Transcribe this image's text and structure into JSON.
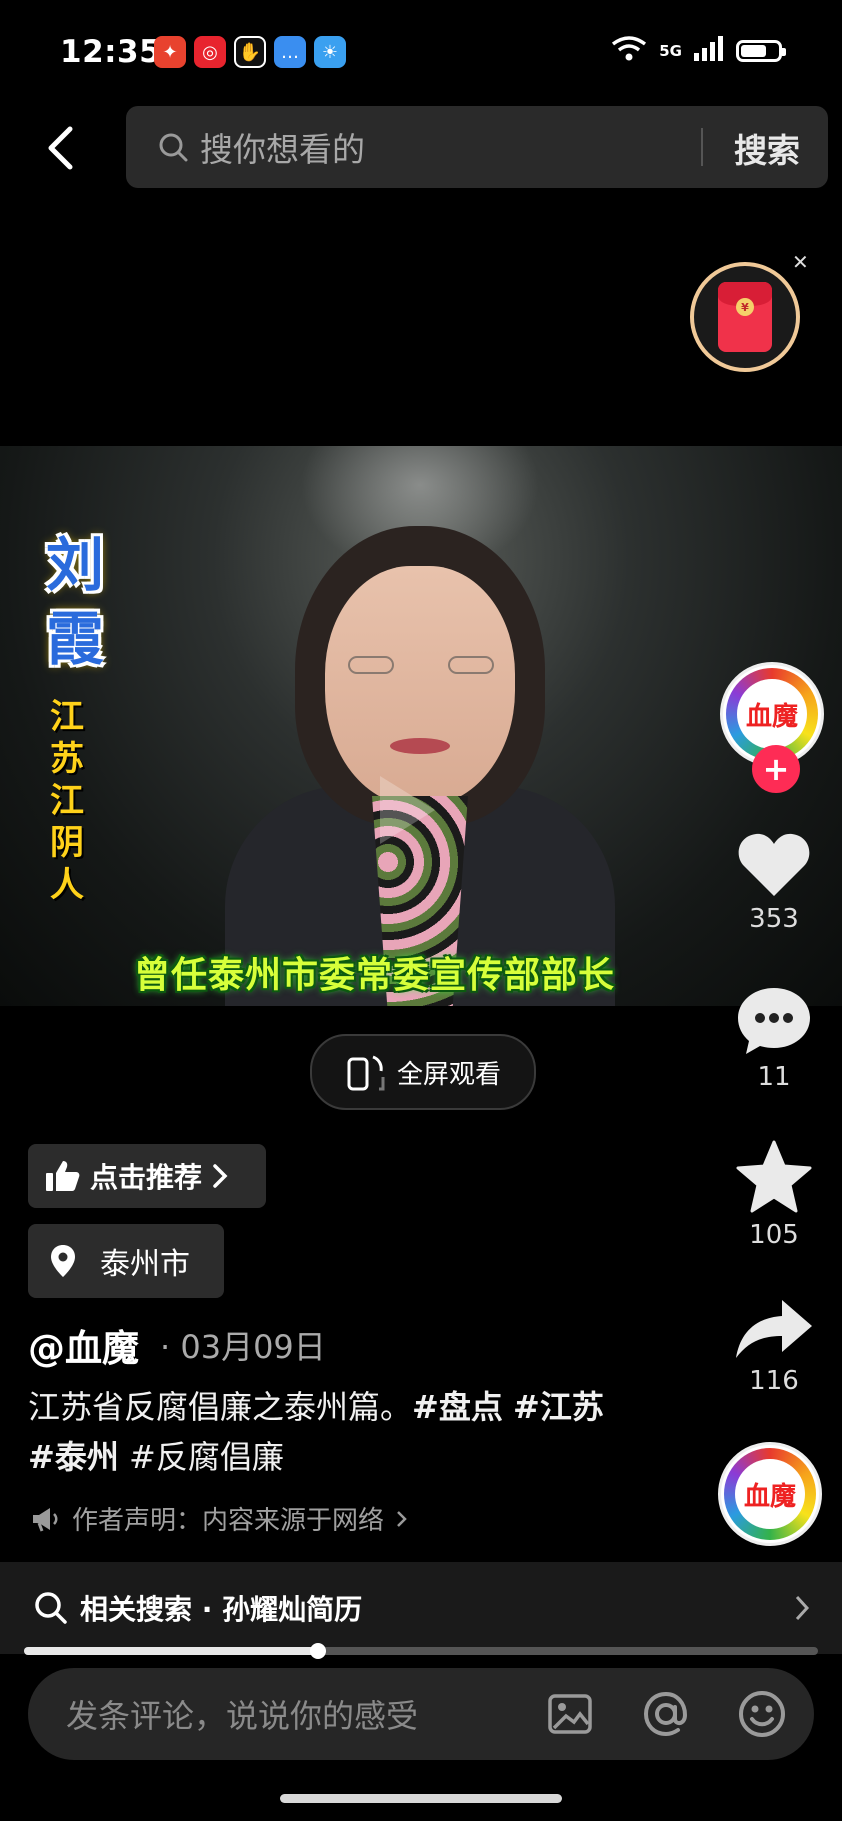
{
  "status_bar": {
    "time": "12:35",
    "signal": "5G",
    "wifi_tag": "6",
    "battery_level": 0.7
  },
  "search": {
    "placeholder": "搜你想看的",
    "button": "搜索"
  },
  "video": {
    "name_text": "刘霞",
    "origin_text": "江苏江阴人",
    "caption": "曾任泰州市委常委宣传部部长"
  },
  "side_actions": {
    "avatar_text": "血魔",
    "like_count": "353",
    "comment_count": "11",
    "favorite_count": "105",
    "share_count": "116",
    "music_avatar_text": "血魔"
  },
  "fullscreen_label": "全屏观看",
  "recommend_label": "点击推荐",
  "location_label": "泰州市",
  "post": {
    "author": "@血魔",
    "date": "· 03月09日",
    "desc_plain": "江苏省反腐倡廉之泰州篇。",
    "tag1": "#盘点",
    "tag2": "#江苏",
    "tag3": "#泰州",
    "tag4": "#反腐倡廉",
    "statement": "作者声明：内容来源于网络"
  },
  "related": {
    "label": "相关搜索 · 孙耀灿简历"
  },
  "progress": 0.37,
  "comment_placeholder": "发条评论，说说你的感受"
}
